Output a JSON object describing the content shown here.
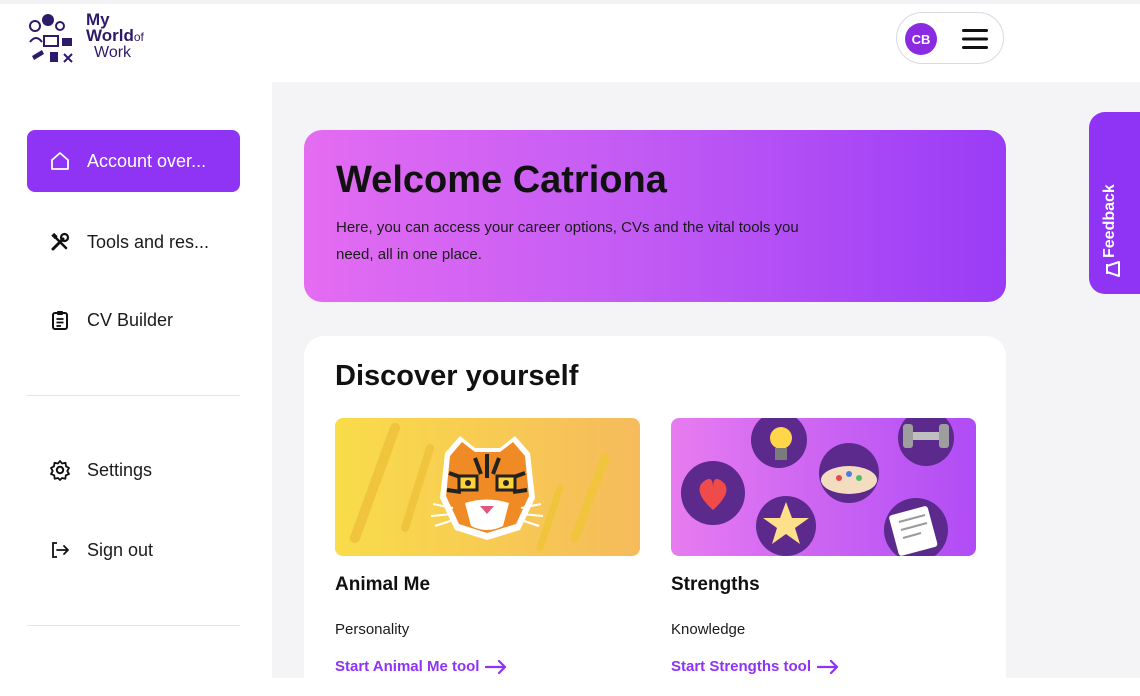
{
  "logo": {
    "line1": "My",
    "line2": "World",
    "line2_small": "of",
    "line3": "Work"
  },
  "header": {
    "avatar_initials": "CB"
  },
  "sidebar": {
    "items": [
      {
        "label": "Account over...",
        "icon": "home-icon",
        "active": true
      },
      {
        "label": "Tools and res...",
        "icon": "tools-icon"
      },
      {
        "label": "CV Builder",
        "icon": "clipboard-icon"
      },
      {
        "label": "Settings",
        "icon": "gear-icon"
      },
      {
        "label": "Sign out",
        "icon": "sign-out-icon"
      }
    ]
  },
  "welcome": {
    "title": "Welcome Catriona",
    "text": "Here, you can access your career options, CVs and the vital tools you need, all in one place."
  },
  "discover": {
    "title": "Discover yourself",
    "cards": [
      {
        "title": "Animal Me",
        "subtitle": "Personality",
        "link": "Start Animal Me tool",
        "image": "tiger-illustration"
      },
      {
        "title": "Strengths",
        "subtitle": "Knowledge",
        "link": "Start Strengths tool",
        "image": "strengths-illustration"
      }
    ]
  },
  "feedback": {
    "label": "Feedback"
  },
  "colors": {
    "accent": "#8f33f5",
    "welcome_start": "#e46cf2",
    "welcome_end": "#9a3cf6",
    "brand_text": "#2d1b69"
  }
}
